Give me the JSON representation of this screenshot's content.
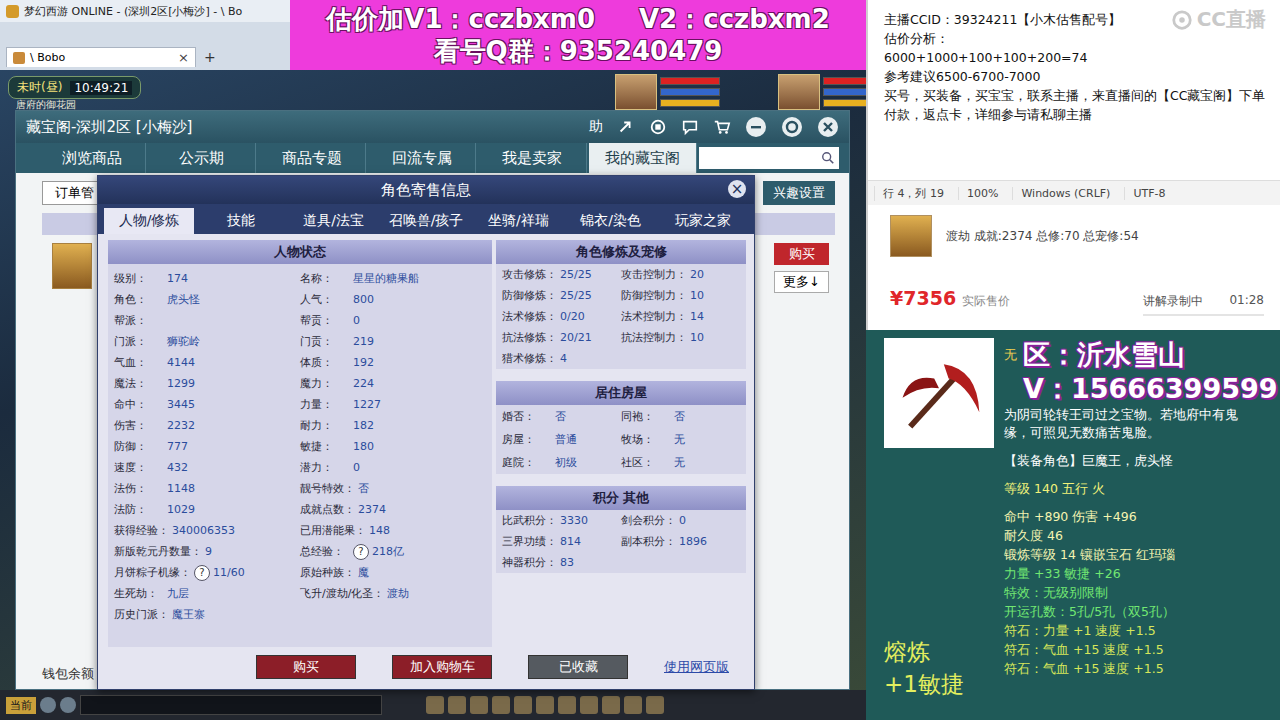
{
  "game": {
    "window_title": "梦幻西游 ONLINE - (深圳2区[小梅沙] - \\ Bo",
    "browser_tab": {
      "label": "\\ Bobo",
      "close": "×",
      "selected": true
    },
    "new_tab": "+",
    "hud": {
      "time_period": "未时(昼)",
      "clock": "10:49:21",
      "location": "唐府的御花园"
    },
    "portraits": [
      {
        "bars": [
          1,
          1,
          1
        ]
      },
      {
        "bars": [
          1,
          1,
          1
        ]
      }
    ],
    "chat_bar": {
      "channel": "当前"
    }
  },
  "banner": {
    "line1": [
      "估价加V1：cczbxm0",
      "V2：cczbxm2"
    ],
    "line2": "看号Q群：935240479"
  },
  "cbg": {
    "title": "藏宝阁-深圳2区 [小梅沙]",
    "help": "助",
    "tabs": [
      {
        "label": "浏览商品",
        "selected": false
      },
      {
        "label": "公示期",
        "selected": false
      },
      {
        "label": "商品专题",
        "selected": false
      },
      {
        "label": "回流专属",
        "selected": false
      },
      {
        "label": "我是卖家",
        "selected": false
      },
      {
        "label": "我的藏宝阁",
        "selected": true
      }
    ],
    "order_button": "订单管",
    "interest_button": "兴趣设置",
    "buy": "购买",
    "more": "更多↓",
    "wallet": "钱包余额"
  },
  "dialog": {
    "title": "角色寄售信息",
    "close": "×",
    "tabs": [
      {
        "label": "人物/修炼",
        "selected": true
      },
      {
        "label": "技能",
        "selected": false
      },
      {
        "label": "道具/法宝",
        "selected": false
      },
      {
        "label": "召唤兽/孩子",
        "selected": false
      },
      {
        "label": "坐骑/祥瑞",
        "selected": false
      },
      {
        "label": "锦衣/染色",
        "selected": false
      },
      {
        "label": "玩家之家",
        "selected": false
      }
    ],
    "status": {
      "title": "人物状态",
      "rows": [
        [
          {
            "label": "级别：",
            "value": "174"
          },
          {
            "label": "名称：",
            "value": "星星的糖果船"
          }
        ],
        [
          {
            "label": "角色：",
            "value": "虎头怪"
          },
          {
            "label": "人气：",
            "value": "800"
          }
        ],
        [
          {
            "label": "帮派：",
            "value": ""
          },
          {
            "label": "帮贡：",
            "value": "0"
          }
        ],
        [
          {
            "label": "门派：",
            "value": "狮驼岭"
          },
          {
            "label": "门贡：",
            "value": "219"
          }
        ],
        [
          {
            "label": "气血：",
            "value": "4144"
          },
          {
            "label": "体质：",
            "value": "192"
          }
        ],
        [
          {
            "label": "魔法：",
            "value": "1299"
          },
          {
            "label": "魔力：",
            "value": "224"
          }
        ],
        [
          {
            "label": "命中：",
            "value": "3445"
          },
          {
            "label": "力量：",
            "value": "1227"
          }
        ],
        [
          {
            "label": "伤害：",
            "value": "2232"
          },
          {
            "label": "耐力：",
            "value": "182"
          }
        ],
        [
          {
            "label": "防御：",
            "value": "777"
          },
          {
            "label": "敏捷：",
            "value": "180"
          }
        ],
        [
          {
            "label": "速度：",
            "value": "432"
          },
          {
            "label": "潜力：",
            "value": "0"
          }
        ],
        [
          {
            "label": "法伤：",
            "value": "1148"
          },
          {
            "label": "靓号特效：",
            "value": "否"
          }
        ],
        [
          {
            "label": "法防：",
            "value": "1029"
          },
          {
            "label": "成就点数：",
            "value": "2374"
          }
        ],
        [
          {
            "label": "获得经验：",
            "value": "340006353"
          },
          {
            "label": "已用潜能果：",
            "value": "148"
          }
        ],
        [
          {
            "label": "新版乾元丹数量：",
            "value": "9"
          },
          {
            "label": "总经验：",
            "help": "?",
            "value": "218亿"
          }
        ],
        [
          {
            "label": "月饼粽子机缘：",
            "help": "?",
            "value": "11/60"
          },
          {
            "label": "原始种族：",
            "value": "魔"
          }
        ],
        [
          {
            "label": "生死劫：",
            "value": "九层"
          },
          {
            "label": "飞升/渡劫/化圣：",
            "value": "渡劫"
          }
        ],
        [
          {
            "label": "历史门派：",
            "value": "魔王寨"
          }
        ]
      ]
    },
    "cultivation": {
      "title": "角色修炼及宠修",
      "rows": [
        [
          {
            "label": "攻击修炼：",
            "value": "25/25"
          },
          {
            "label": "攻击控制力：",
            "value": "20"
          }
        ],
        [
          {
            "label": "防御修炼：",
            "value": "25/25"
          },
          {
            "label": "防御控制力：",
            "value": "10"
          }
        ],
        [
          {
            "label": "法术修炼：",
            "value": "0/20"
          },
          {
            "label": "法术控制力：",
            "value": "14"
          }
        ],
        [
          {
            "label": "抗法修炼：",
            "value": "20/21"
          },
          {
            "label": "抗法控制力：",
            "value": "10"
          }
        ],
        [
          {
            "label": "猎术修炼：",
            "value": "4"
          }
        ]
      ]
    },
    "housing": {
      "title": "居住房屋",
      "rows": [
        [
          {
            "label": "婚否：",
            "value": "否"
          },
          {
            "label": "同袍：",
            "value": "否"
          }
        ],
        [
          {
            "label": "房屋：",
            "value": "普通"
          },
          {
            "label": "牧场：",
            "value": "无"
          }
        ],
        [
          {
            "label": "庭院：",
            "value": "初级"
          },
          {
            "label": "社区：",
            "value": "无"
          }
        ]
      ]
    },
    "points": {
      "title": "积分 其他",
      "rows": [
        [
          {
            "label": "比武积分：",
            "value": "3330"
          },
          {
            "label": "剑会积分：",
            "value": "0"
          }
        ],
        [
          {
            "label": "三界功绩：",
            "value": "814"
          },
          {
            "label": "副本积分：",
            "value": "1896"
          }
        ],
        [
          {
            "label": "神器积分：",
            "value": "83"
          }
        ]
      ]
    },
    "buttons": [
      {
        "label": "购买",
        "kind": "red"
      },
      {
        "label": "加入购物车",
        "kind": "red"
      },
      {
        "label": "已收藏",
        "kind": "gray"
      }
    ],
    "web_link": "使用网页版"
  },
  "notepad": {
    "lines": [
      "主播CCID：39324211【小木估售配号】",
      "估价分析：",
      "6000+1000+100+100+200=74",
      "参考建议6500-6700-7000",
      "买号，买装备，买宝宝，联系主播，来直播间的【CC藏宝阁】下单付款，返点卡，详细参与请私聊主播"
    ],
    "status": [
      "行 4，列 19",
      "100%",
      "Windows (CRLF)",
      "UTF-8"
    ]
  },
  "watermark": "CC直播",
  "listing": {
    "summary": "渡劫 成就:2374 总修:70 总宠修:54",
    "price": "¥7356",
    "price_label": "实际售价",
    "recording": "讲解录制中",
    "timer": "01:28"
  },
  "item": {
    "name": "无",
    "overlay": [
      "区：沂水雪山",
      "V：15666399599"
    ],
    "description": [
      "为阴司轮转王司过之宝物。若地府中有鬼",
      "缘，可照见无数痛苦鬼脸。"
    ],
    "groups": [
      [
        {
          "text": "【装备角色】巨魔王，虎头怪",
          "color": "#ffffff"
        }
      ],
      [
        {
          "text": "等级 140  五行 火",
          "color": "#f2f27a"
        }
      ],
      [
        {
          "text": "命中 +890 伤害 +496",
          "color": "#f4f4b0"
        },
        {
          "text": "耐久度 46",
          "color": "#f4f4b0"
        },
        {
          "text": "锻炼等级 14  镶嵌宝石 红玛瑙",
          "color": "#f4f4b0"
        },
        {
          "text": "力量 +33 敏捷 +26",
          "color": "#72e872"
        },
        {
          "text": "特效：无级别限制",
          "color": "#72e872"
        },
        {
          "text": "开运孔数：5孔/5孔（双5孔）",
          "color": "#72e872"
        },
        {
          "text": "符石：力量 +1 速度 +1.5",
          "color": "#d6e65a"
        },
        {
          "text": "符石：气血 +15 速度 +1.5",
          "color": "#d6e65a"
        },
        {
          "text": "符石：气血 +15 速度 +1.5",
          "color": "#d6e65a"
        }
      ]
    ],
    "smelt": [
      "熔炼",
      "+1敏捷"
    ]
  }
}
